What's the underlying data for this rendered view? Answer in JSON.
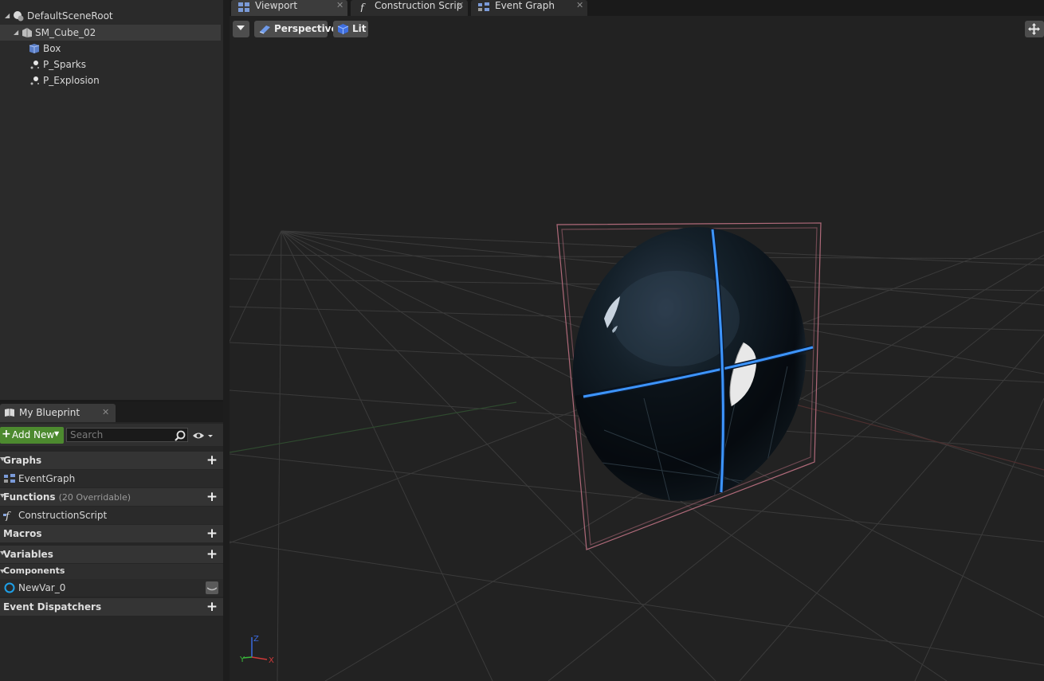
{
  "components": {
    "items": [
      {
        "label": "DefaultSceneRoot"
      },
      {
        "label": "SM_Cube_02"
      },
      {
        "label": "Box"
      },
      {
        "label": "P_Sparks"
      },
      {
        "label": "P_Explosion"
      }
    ]
  },
  "my_blueprint": {
    "tab_label": "My Blueprint",
    "add_new_label": "Add New",
    "search_placeholder": "Search",
    "categories": {
      "graphs": "Graphs",
      "functions": "Functions",
      "functions_sub": "(20 Overridable)",
      "macros": "Macros",
      "variables": "Variables",
      "components": "Components",
      "event_dispatchers": "Event Dispatchers"
    },
    "items": {
      "event_graph": "EventGraph",
      "construction_script": "ConstructionScript",
      "new_var": "NewVar_0"
    }
  },
  "document_tabs": [
    {
      "label": "Viewport",
      "icon": "viewport-icon"
    },
    {
      "label": "Construction Scrip",
      "icon": "function-icon"
    },
    {
      "label": "Event Graph",
      "icon": "graph-icon"
    }
  ],
  "viewport": {
    "view_mode": "Perspective",
    "lighting_mode": "Lit",
    "axis_labels": {
      "x": "X",
      "y": "Y",
      "z": "Z"
    }
  },
  "colors": {
    "add_new_green": "#4d8a2f",
    "seam_blue": "#3d95ff",
    "bounds_pink": "#b06a7a",
    "axis_x": "#d03a3a",
    "axis_y": "#3aba3a",
    "axis_z": "#3a6ae0"
  }
}
